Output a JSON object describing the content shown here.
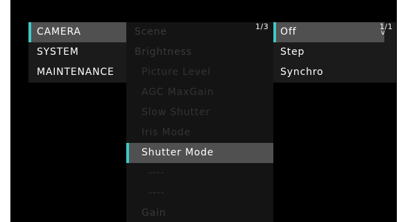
{
  "left_menu": {
    "items": [
      {
        "label": "CAMERA",
        "selected": true
      },
      {
        "label": "SYSTEM",
        "selected": false
      },
      {
        "label": "MAINTENANCE",
        "selected": false
      }
    ]
  },
  "mid_menu": {
    "page": "1/3",
    "items": [
      {
        "label": "Scene"
      },
      {
        "label": "Brightness"
      },
      {
        "label": "Picture Level"
      },
      {
        "label": "AGC MaxGain"
      },
      {
        "label": "Slow Shutter"
      },
      {
        "label": "Iris Mode"
      },
      {
        "label": "Shutter Mode"
      },
      {
        "label": "----"
      },
      {
        "label": "----"
      },
      {
        "label": "Gain"
      }
    ]
  },
  "right_menu": {
    "page": "1/1",
    "scroll_glyph": "v",
    "items": [
      {
        "label": "Off"
      },
      {
        "label": "Step"
      },
      {
        "label": "Synchro"
      }
    ]
  },
  "colors": {
    "accent": "#40c8c8",
    "selected_bg": "#505050",
    "panel_bg": "#1b1b1b"
  }
}
